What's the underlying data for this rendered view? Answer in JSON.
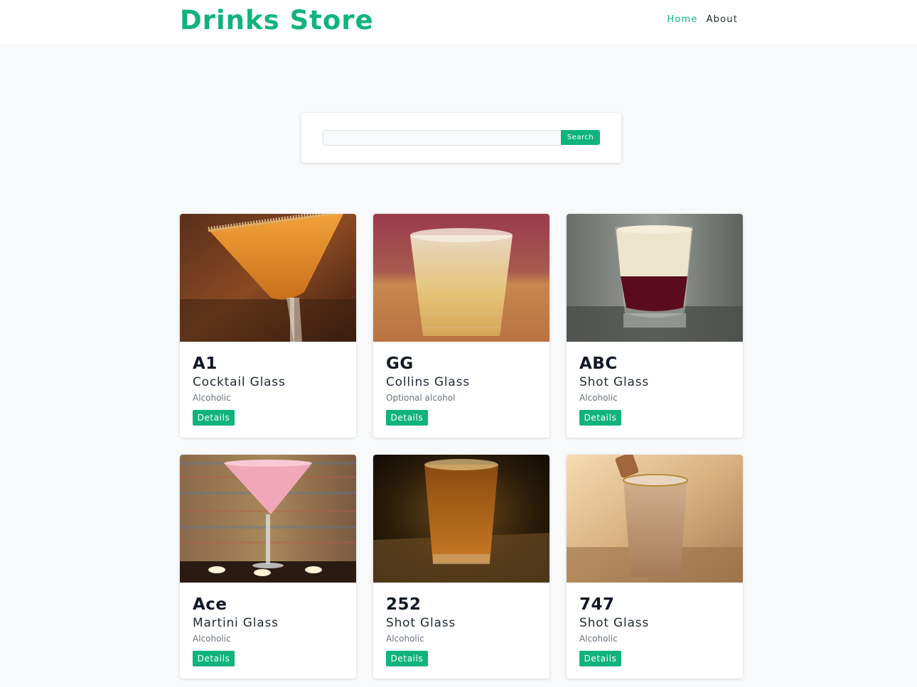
{
  "header": {
    "brand": "Drinks Store",
    "nav": [
      {
        "label": "Home",
        "active": true
      },
      {
        "label": "About",
        "active": false
      }
    ]
  },
  "search": {
    "value": "",
    "placeholder": "",
    "button_label": "Search"
  },
  "cards": [
    {
      "name": "A1",
      "glass": "Cocktail Glass",
      "info": "Alcoholic",
      "button": "Details"
    },
    {
      "name": "GG",
      "glass": "Collins Glass",
      "info": "Optional alcohol",
      "button": "Details"
    },
    {
      "name": "ABC",
      "glass": "Shot Glass",
      "info": "Alcoholic",
      "button": "Details"
    },
    {
      "name": "Ace",
      "glass": "Martini Glass",
      "info": "Alcoholic",
      "button": "Details"
    },
    {
      "name": "252",
      "glass": "Shot Glass",
      "info": "Alcoholic",
      "button": "Details"
    },
    {
      "name": "747",
      "glass": "Shot Glass",
      "info": "Alcoholic",
      "button": "Details"
    }
  ],
  "colors": {
    "accent": "#10b37d",
    "page_bg": "#f8f9fa",
    "card_bg": "#ffffff",
    "heading": "#111827",
    "muted": "#6b7280"
  }
}
